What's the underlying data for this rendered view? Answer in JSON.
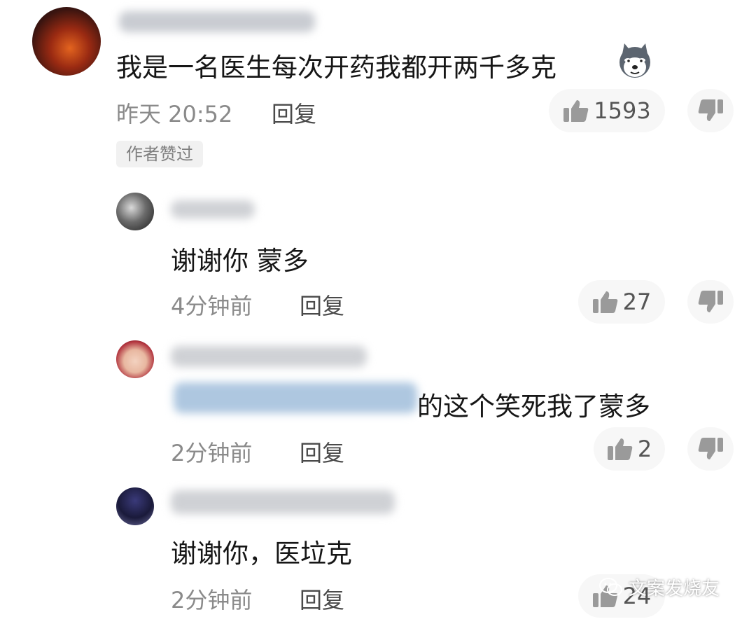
{
  "main_comment": {
    "text": "我是一名医生每次开药我都开两千多克",
    "emoji": "husky-dog-emoji",
    "time": "昨天 20:52",
    "reply_label": "回复",
    "likes": "1593",
    "author_badge": "作者赞过"
  },
  "replies": [
    {
      "text": "谢谢你 蒙多",
      "time": "4分钟前",
      "reply_label": "回复",
      "likes": "27"
    },
    {
      "text": "的这个笑死我了蒙多",
      "time": "2分钟前",
      "reply_label": "回复",
      "likes": "2"
    },
    {
      "text": "谢谢你，医垃克",
      "time": "2分钟前",
      "reply_label": "回复",
      "likes": "24"
    }
  ],
  "watermark": "文案发烧友",
  "icons": {
    "like": "thumbs-up-icon",
    "dislike": "thumbs-down-icon"
  }
}
